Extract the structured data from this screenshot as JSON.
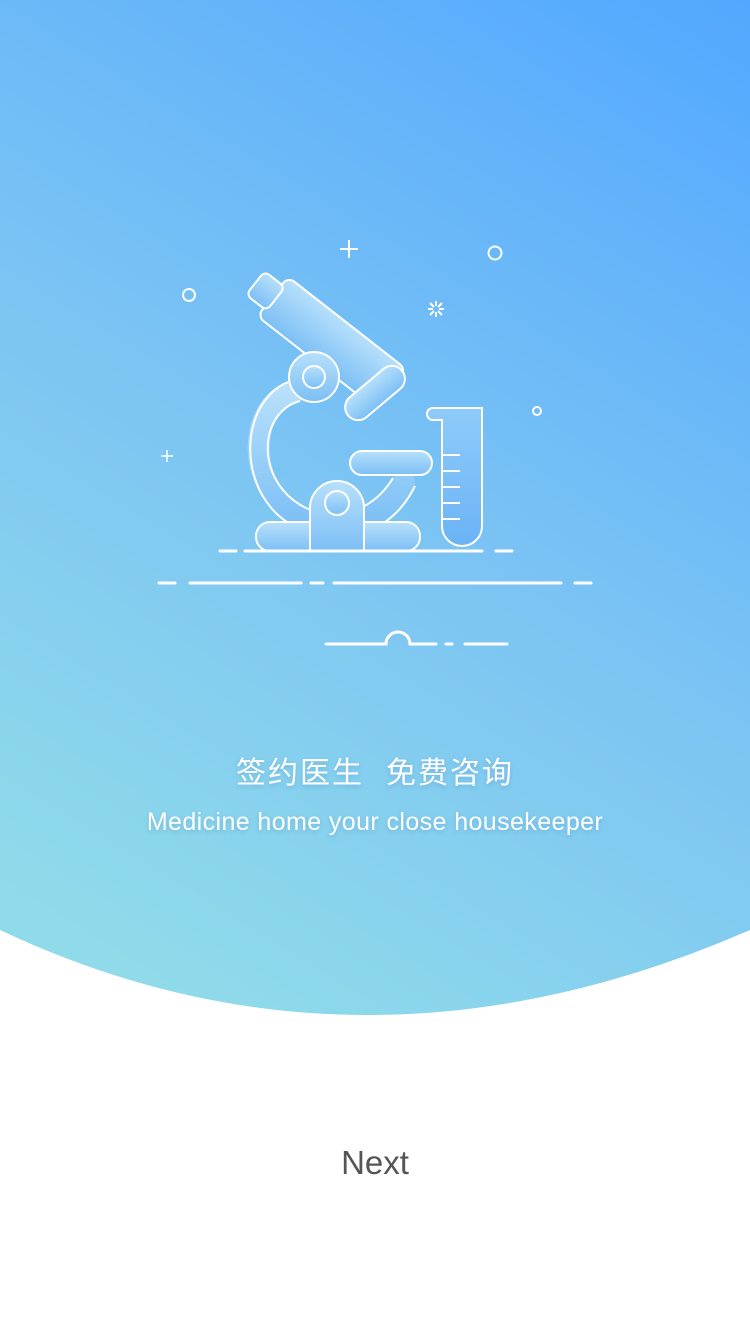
{
  "onboarding": {
    "headline_part1": "签约医生",
    "headline_part2": "免费咨询",
    "subtitle": "Medicine home your close housekeeper",
    "next_label": "Next"
  },
  "illustration": {
    "subject": "microscope-and-test-tube-icon"
  },
  "colors": {
    "gradient_top_right": "#52a8ff",
    "gradient_bottom_left": "#8fdbea",
    "illustration_fill": "#9fd2f8",
    "line": "#ffffff",
    "next_text": "#555555",
    "page_background": "#ffffff"
  }
}
